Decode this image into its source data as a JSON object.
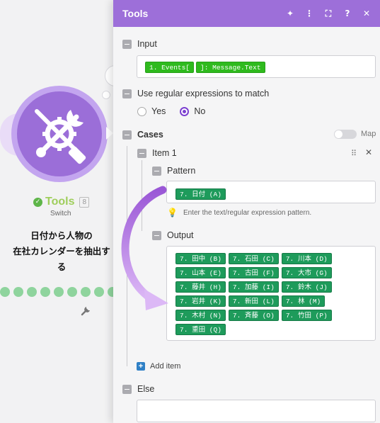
{
  "module": {
    "name": "Tools",
    "badge": "8",
    "subtitle": "Switch",
    "status_icon": "check-icon",
    "main_icon": "wrench-screwdriver-gear-icon"
  },
  "callout": {
    "line1": "日付から人物の",
    "line2": "在社カレンダーを抽出する"
  },
  "panel": {
    "title": "Tools",
    "header_icons": [
      "sparkle-icon",
      "more-vertical-icon",
      "expand-icon",
      "help-icon",
      "close-icon"
    ],
    "header_glyphs": [
      "✦",
      "⋮",
      "⛶",
      "?",
      "✕"
    ]
  },
  "input": {
    "label": "Input",
    "tokens": [
      "1. Events[",
      "]: Message.Text"
    ]
  },
  "regex": {
    "label": "Use regular expressions to match",
    "yes": "Yes",
    "no": "No",
    "selected": "No"
  },
  "cases": {
    "label": "Cases",
    "map_label": "Map",
    "item_label": "Item 1",
    "pattern_label": "Pattern",
    "pattern_token": "7. 日付 (A)",
    "pattern_hint": "Enter the text/regular expression pattern.",
    "output_label": "Output",
    "output_tokens": [
      "7. 田中 (B)",
      "7. 石田 (C)",
      "7. 川本 (D)",
      "7. 山本 (E)",
      "7. 古田 (F)",
      "7. 大市 (G)",
      "7. 藤井 (H)",
      "7. 加藤 (I)",
      "7. 鈴木 (J)",
      "7. 岩井 (K)",
      "7. 新田 (L)",
      "7. 林 (M)",
      "7. 木村 (N)",
      "7. 斉藤 (O)",
      "7. 竹田 (P)",
      "7. 重田 (Q)"
    ],
    "add_item": "Add item"
  },
  "else": {
    "label": "Else"
  },
  "colors": {
    "header": "#9d6fd9",
    "token": "#1e9b5b",
    "token_bright": "#2fba1e",
    "radio_accent": "#7b3fd0",
    "module_accent": "#9fce5c"
  }
}
